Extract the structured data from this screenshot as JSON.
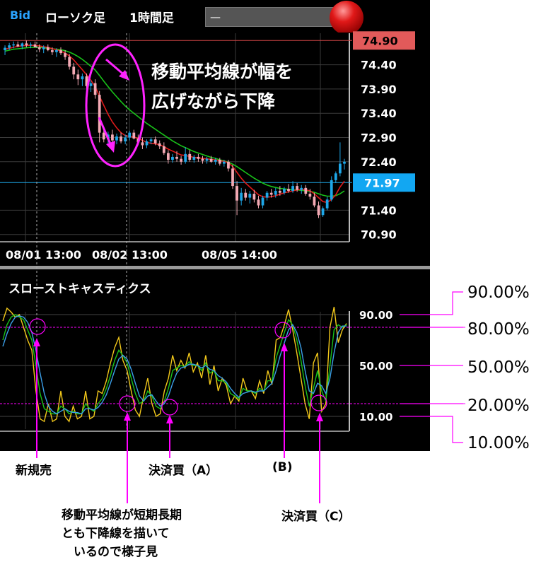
{
  "header": {
    "bid": "Bid",
    "chart_type": "ローソク足",
    "timeframe": "1時間足",
    "selector_value": "—"
  },
  "price_panel": {
    "current_price": "74.90",
    "last_price": "71.97",
    "note_line1": "移動平均線が幅を",
    "note_line2": "広げながら下降"
  },
  "oscillator_panel": {
    "title": "スローストキャスティクス"
  },
  "right_labels": [
    "90.00%",
    "80.00%",
    "50.00%",
    "20.00%",
    "10.00%"
  ],
  "annotations": {
    "new_sell": "新規売",
    "close_a": "決済買（A）",
    "label_b": "(B)",
    "close_c": "決済買（C）",
    "wait_line1": "移動平均線が短期長期",
    "wait_line2": "とも下降線を描いて",
    "wait_line3": "いるので様子見"
  },
  "colors": {
    "up_candle": "#1ea7e8",
    "down_candle": "#f3a9b4",
    "ma_short": "#e01b1b",
    "ma_long": "#19c219",
    "stoch_fast": "#f2c81a",
    "stoch_k": "#19c219",
    "stoch_d": "#3b9fe8",
    "marker": "#ff00ff",
    "price_tag": "#e25a5a",
    "last_tag": "#12a7f2"
  },
  "chart_data": [
    {
      "type": "candlestick",
      "title": "",
      "y_ticks": [
        74.4,
        73.9,
        73.4,
        72.9,
        72.4,
        71.4,
        70.9
      ],
      "x_ticks": [
        "08/01 13:00",
        "08/02 13:00",
        "08/05 14:00"
      ],
      "ylim": [
        70.75,
        75.05
      ],
      "grid": true,
      "ohlc": [
        [
          74.7,
          74.8,
          74.6,
          74.75
        ],
        [
          74.75,
          74.85,
          74.7,
          74.8
        ],
        [
          74.8,
          74.88,
          74.74,
          74.82
        ],
        [
          74.82,
          74.88,
          74.76,
          74.78
        ],
        [
          74.78,
          74.86,
          74.72,
          74.84
        ],
        [
          74.84,
          74.9,
          74.76,
          74.8
        ],
        [
          74.8,
          74.86,
          74.74,
          74.82
        ],
        [
          74.82,
          74.88,
          74.76,
          74.76
        ],
        [
          74.76,
          74.82,
          74.66,
          74.72
        ],
        [
          74.72,
          74.8,
          74.64,
          74.76
        ],
        [
          74.76,
          74.82,
          74.68,
          74.7
        ],
        [
          74.7,
          74.76,
          74.6,
          74.66
        ],
        [
          74.66,
          74.74,
          74.56,
          74.7
        ],
        [
          74.7,
          74.76,
          74.6,
          74.64
        ],
        [
          74.64,
          74.7,
          74.5,
          74.56
        ],
        [
          74.56,
          74.62,
          74.3,
          74.36
        ],
        [
          74.36,
          74.44,
          74.1,
          74.2
        ],
        [
          74.2,
          74.3,
          73.98,
          74.1
        ],
        [
          74.1,
          74.22,
          73.96,
          74.16
        ],
        [
          74.16,
          74.22,
          73.9,
          73.96
        ],
        [
          73.96,
          74.08,
          73.84,
          74.02
        ],
        [
          74.02,
          74.1,
          73.7,
          73.78
        ],
        [
          73.78,
          73.86,
          72.8,
          73.0
        ],
        [
          73.0,
          73.12,
          72.8,
          72.86
        ],
        [
          72.86,
          73.02,
          72.74,
          72.96
        ],
        [
          72.96,
          73.06,
          72.8,
          72.84
        ],
        [
          72.84,
          72.98,
          72.76,
          72.92
        ],
        [
          72.92,
          73.0,
          72.78,
          72.82
        ],
        [
          72.82,
          72.96,
          72.76,
          72.9
        ],
        [
          72.9,
          73.04,
          72.84,
          73.0
        ],
        [
          73.0,
          73.06,
          72.86,
          72.88
        ],
        [
          72.88,
          72.96,
          72.74,
          72.8
        ],
        [
          72.8,
          72.9,
          72.66,
          72.74
        ],
        [
          72.74,
          72.86,
          72.68,
          72.82
        ],
        [
          72.82,
          72.9,
          72.76,
          72.86
        ],
        [
          72.86,
          72.92,
          72.74,
          72.78
        ],
        [
          72.78,
          72.84,
          72.66,
          72.72
        ],
        [
          72.72,
          72.8,
          72.54,
          72.58
        ],
        [
          72.58,
          72.64,
          72.36,
          72.44
        ],
        [
          72.44,
          72.56,
          72.38,
          72.5
        ],
        [
          72.5,
          72.62,
          72.4,
          72.46
        ],
        [
          72.46,
          72.52,
          72.34,
          72.4
        ],
        [
          72.4,
          72.7,
          72.36,
          72.56
        ],
        [
          72.56,
          72.64,
          72.4,
          72.44
        ],
        [
          72.44,
          72.54,
          72.38,
          72.5
        ],
        [
          72.5,
          72.56,
          72.4,
          72.46
        ],
        [
          72.46,
          72.52,
          72.36,
          72.42
        ],
        [
          72.42,
          72.5,
          72.36,
          72.46
        ],
        [
          72.46,
          72.52,
          72.38,
          72.4
        ],
        [
          72.4,
          72.48,
          72.34,
          72.44
        ],
        [
          72.44,
          72.48,
          72.32,
          72.36
        ],
        [
          72.36,
          72.44,
          72.3,
          72.4
        ],
        [
          72.4,
          72.44,
          72.2,
          72.26
        ],
        [
          72.26,
          72.34,
          71.84,
          71.9
        ],
        [
          71.9,
          72.0,
          71.3,
          71.6
        ],
        [
          71.6,
          71.86,
          71.5,
          71.76
        ],
        [
          71.76,
          71.84,
          71.6,
          71.66
        ],
        [
          71.66,
          71.8,
          71.54,
          71.74
        ],
        [
          71.74,
          71.82,
          71.56,
          71.62
        ],
        [
          71.62,
          71.7,
          71.44,
          71.5
        ],
        [
          71.5,
          71.7,
          71.44,
          71.66
        ],
        [
          71.66,
          71.8,
          71.6,
          71.76
        ],
        [
          71.76,
          71.84,
          71.66,
          71.72
        ],
        [
          71.72,
          71.86,
          71.66,
          71.8
        ],
        [
          71.8,
          71.9,
          71.7,
          71.76
        ],
        [
          71.76,
          71.88,
          71.72,
          71.84
        ],
        [
          71.84,
          71.94,
          71.76,
          71.8
        ],
        [
          71.8,
          72.0,
          71.76,
          71.9
        ],
        [
          71.9,
          71.96,
          71.78,
          71.82
        ],
        [
          71.82,
          71.92,
          71.74,
          71.86
        ],
        [
          71.86,
          71.92,
          71.7,
          71.74
        ],
        [
          71.74,
          71.84,
          71.62,
          71.68
        ],
        [
          71.68,
          71.76,
          71.46,
          71.5
        ],
        [
          71.5,
          71.58,
          71.24,
          71.3
        ],
        [
          71.3,
          71.48,
          71.26,
          71.44
        ],
        [
          71.44,
          71.68,
          71.4,
          71.62
        ],
        [
          71.62,
          72.1,
          71.58,
          72.02
        ],
        [
          72.02,
          72.2,
          71.96,
          72.16
        ],
        [
          72.16,
          72.8,
          72.1,
          72.36
        ],
        [
          72.36,
          72.46,
          72.24,
          72.4
        ]
      ],
      "ma_short": [
        74.72,
        74.74,
        74.76,
        74.78,
        74.79,
        74.8,
        74.8,
        74.8,
        74.79,
        74.77,
        74.76,
        74.73,
        74.71,
        74.68,
        74.64,
        74.58,
        74.5,
        74.4,
        74.3,
        74.19,
        74.08,
        73.95,
        73.75,
        73.56,
        73.38,
        73.22,
        73.1,
        73.0,
        72.94,
        72.92,
        72.91,
        72.88,
        72.84,
        72.8,
        72.78,
        72.77,
        72.75,
        72.71,
        72.66,
        72.62,
        72.58,
        72.54,
        72.53,
        72.51,
        72.49,
        72.48,
        72.47,
        72.46,
        72.45,
        72.44,
        72.42,
        72.41,
        72.38,
        72.3,
        72.18,
        72.06,
        71.96,
        71.88,
        71.8,
        71.72,
        71.68,
        71.67,
        71.68,
        71.7,
        71.73,
        71.76,
        71.78,
        71.8,
        71.82,
        71.83,
        71.82,
        71.8,
        71.74,
        71.66,
        71.58,
        71.56,
        71.62,
        71.72,
        71.88,
        72.0
      ],
      "ma_long": [
        74.68,
        74.7,
        74.72,
        74.73,
        74.74,
        74.75,
        74.76,
        74.76,
        74.76,
        74.75,
        74.74,
        74.73,
        74.72,
        74.71,
        74.69,
        74.66,
        74.62,
        74.57,
        74.51,
        74.44,
        74.37,
        74.29,
        74.18,
        74.06,
        73.95,
        73.84,
        73.74,
        73.64,
        73.55,
        73.47,
        73.4,
        73.33,
        73.26,
        73.19,
        73.13,
        73.07,
        73.01,
        72.95,
        72.89,
        72.83,
        72.78,
        72.73,
        72.69,
        72.65,
        72.61,
        72.58,
        72.55,
        72.52,
        72.49,
        72.47,
        72.44,
        72.42,
        72.39,
        72.35,
        72.3,
        72.24,
        72.18,
        72.12,
        72.06,
        72.01,
        71.96,
        71.92,
        71.89,
        71.87,
        71.85,
        71.84,
        71.83,
        71.82,
        71.82,
        71.81,
        71.8,
        71.79,
        71.77,
        71.74,
        71.71,
        71.69,
        71.69,
        71.7,
        71.74,
        71.8
      ]
    },
    {
      "type": "line",
      "title": "スローストキャスティクス",
      "y_ticks": [
        90.0,
        50.0,
        10.0
      ],
      "ylim": [
        0,
        100
      ],
      "reference_levels": [
        90,
        80,
        50,
        20,
        10
      ],
      "series": [
        {
          "values": [
            85,
            95,
            92,
            88,
            90,
            80,
            70,
            62,
            30,
            8,
            6,
            20,
            6,
            8,
            30,
            10,
            6,
            18,
            8,
            10,
            30,
            8,
            10,
            30,
            28,
            38,
            52,
            64,
            72,
            54,
            46,
            30,
            15,
            10,
            26,
            40,
            20,
            10,
            12,
            30,
            40,
            58,
            46,
            54,
            48,
            60,
            45,
            52,
            40,
            58,
            35,
            50,
            30,
            40,
            34,
            20,
            26,
            22,
            40,
            30,
            30,
            24,
            38,
            28,
            46,
            35,
            70,
            72,
            82,
            94,
            78,
            60,
            40,
            20,
            8,
            52,
            60,
            14,
            20,
            80,
            96,
            68,
            78,
            83
          ]
        },
        {
          "values": [
            70,
            82,
            88,
            90,
            88,
            86,
            78,
            70,
            50,
            28,
            16,
            14,
            12,
            12,
            18,
            16,
            12,
            14,
            12,
            12,
            20,
            16,
            14,
            20,
            24,
            32,
            42,
            54,
            62,
            58,
            52,
            40,
            28,
            20,
            22,
            30,
            26,
            18,
            16,
            22,
            32,
            46,
            48,
            50,
            49,
            53,
            50,
            50,
            46,
            52,
            44,
            46,
            38,
            38,
            36,
            28,
            26,
            24,
            32,
            30,
            30,
            28,
            32,
            30,
            38,
            38,
            56,
            66,
            76,
            86,
            82,
            70,
            54,
            34,
            18,
            32,
            46,
            30,
            22,
            50,
            78,
            82,
            80,
            82
          ]
        },
        {
          "values": [
            65,
            75,
            83,
            88,
            89,
            88,
            84,
            76,
            62,
            44,
            28,
            18,
            14,
            12,
            14,
            16,
            14,
            13,
            13,
            12,
            16,
            16,
            15,
            17,
            21,
            27,
            36,
            46,
            55,
            58,
            55,
            47,
            36,
            26,
            22,
            26,
            27,
            22,
            18,
            20,
            26,
            36,
            44,
            48,
            49,
            51,
            51,
            50,
            48,
            50,
            47,
            46,
            42,
            40,
            37,
            32,
            28,
            25,
            28,
            29,
            30,
            29,
            30,
            30,
            33,
            36,
            46,
            58,
            68,
            78,
            82,
            76,
            64,
            46,
            30,
            28,
            36,
            34,
            28,
            40,
            60,
            76,
            81,
            81
          ]
        }
      ]
    }
  ]
}
